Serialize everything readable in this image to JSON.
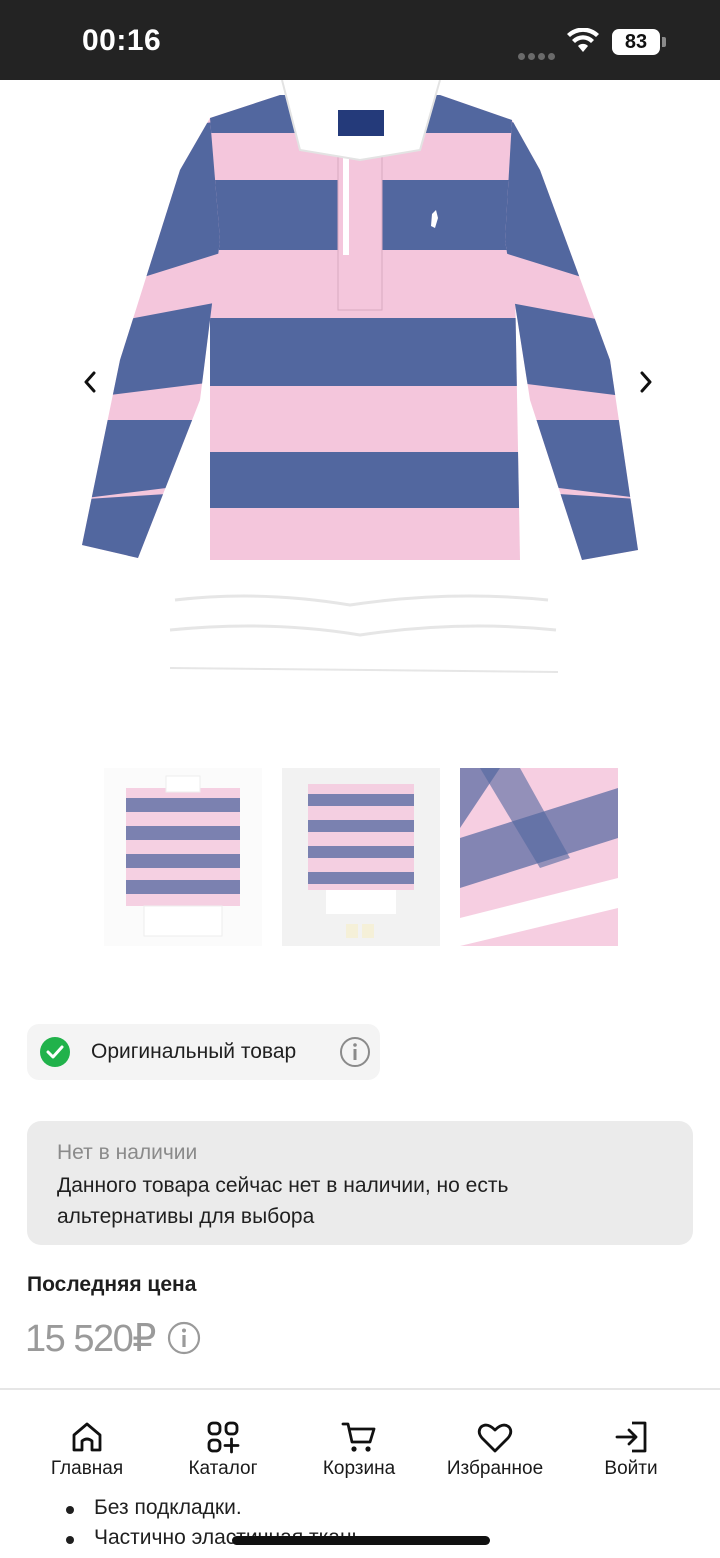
{
  "status_bar": {
    "time": "00:16",
    "battery": "83"
  },
  "product_image_alt": "Polo Ralph Lauren",
  "original_badge": {
    "label": "Оригинальный товар",
    "color": "#21b24b"
  },
  "stock": {
    "title": "Нет в наличии",
    "text": "Данного товара сейчас нет в наличии, но есть альтернативы для выбора"
  },
  "price": {
    "heading": "Последняя цена",
    "value": "15 520₽"
  },
  "nav": {
    "items": [
      {
        "label": "Главная",
        "icon": "home-icon"
      },
      {
        "label": "Каталог",
        "icon": "catalog-icon"
      },
      {
        "label": "Корзина",
        "icon": "cart-icon"
      },
      {
        "label": "Избранное",
        "icon": "heart-icon"
      },
      {
        "label": "Войти",
        "icon": "login-icon"
      }
    ]
  },
  "details": [
    "Без подкладки.",
    "Частично эластичная ткань."
  ],
  "colors": {
    "stripe_blue": "#52679f",
    "stripe_pink": "#f4c6dc",
    "accent_green": "#21b24b"
  }
}
